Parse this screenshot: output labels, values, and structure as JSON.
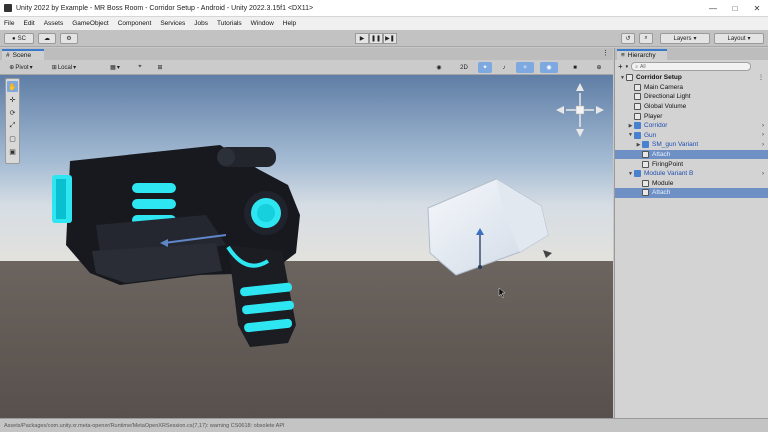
{
  "window": {
    "title": "Unity 2022 by Example - MR Boss Room - Corridor Setup - Android - Unity 2022.3.15f1 <DX11>",
    "controls": [
      "—",
      "□",
      "✕"
    ]
  },
  "menu": [
    "File",
    "Edit",
    "Assets",
    "GameObject",
    "Component",
    "Services",
    "Jobs",
    "Tutorials",
    "Window",
    "Help"
  ],
  "toolbar": {
    "account_label": "SC",
    "account_icon": "●",
    "cloud_icon": "☁",
    "settings_icon": "⚙",
    "play_icon": "▶",
    "pause_icon": "❚❚",
    "step_icon": "▶❚",
    "history_icon": "↺",
    "search_icon": "⌕",
    "layers_label": "Layers",
    "layout_label": "Layout"
  },
  "scene": {
    "tab_label": "Scene",
    "tab_icon": "#",
    "pivot_label": "Pivot",
    "local_label": "Local",
    "view_2d_label": "2D",
    "grid_icon": "▦",
    "snap_icon": "⌖",
    "gizmo_toggle": "◉",
    "menu_icon": "⋮"
  },
  "tools": [
    "✋",
    "✛",
    "⟳",
    "⤢",
    "▢",
    "▣"
  ],
  "hierarchy": {
    "tab_label": "Hierarchy",
    "tab_icon": "≡",
    "add_icon": "+",
    "search_placeholder": "All",
    "search_icon": "⌕",
    "items": [
      {
        "label": "Corridor Setup",
        "depth": 0,
        "arrow": "▼",
        "bold": true,
        "icon": "cube-gray",
        "selected": false,
        "blue": false,
        "more": true
      },
      {
        "label": "Main Camera",
        "depth": 1,
        "arrow": "",
        "bold": false,
        "icon": "cube-gray",
        "selected": false,
        "blue": false,
        "more": false
      },
      {
        "label": "Directional Light",
        "depth": 1,
        "arrow": "",
        "bold": false,
        "icon": "cube-gray",
        "selected": false,
        "blue": false,
        "more": false
      },
      {
        "label": "Global Volume",
        "depth": 1,
        "arrow": "",
        "bold": false,
        "icon": "cube-gray",
        "selected": false,
        "blue": false,
        "more": false
      },
      {
        "label": "Player",
        "depth": 1,
        "arrow": "",
        "bold": false,
        "icon": "cube-gray",
        "selected": false,
        "blue": false,
        "more": false
      },
      {
        "label": "Corridor",
        "depth": 1,
        "arrow": "▶",
        "bold": false,
        "icon": "cube-blue",
        "selected": false,
        "blue": true,
        "more": true
      },
      {
        "label": "Gun",
        "depth": 1,
        "arrow": "▼",
        "bold": false,
        "icon": "cube-blue",
        "selected": false,
        "blue": true,
        "more": true
      },
      {
        "label": "SM_gun Variant",
        "depth": 2,
        "arrow": "▶",
        "bold": false,
        "icon": "cube-blue",
        "selected": false,
        "blue": true,
        "more": true
      },
      {
        "label": "Attach",
        "depth": 2,
        "arrow": "",
        "bold": false,
        "icon": "cube-gray",
        "selected": true,
        "blue": false,
        "more": false
      },
      {
        "label": "FiringPoint",
        "depth": 2,
        "arrow": "",
        "bold": false,
        "icon": "cube-gray",
        "selected": false,
        "blue": false,
        "more": false
      },
      {
        "label": "Module Variant B",
        "depth": 1,
        "arrow": "▼",
        "bold": false,
        "icon": "cube-blue",
        "selected": false,
        "blue": true,
        "more": true
      },
      {
        "label": "Module",
        "depth": 2,
        "arrow": "",
        "bold": false,
        "icon": "cube-gray",
        "selected": false,
        "blue": false,
        "more": false
      },
      {
        "label": "Attach",
        "depth": 2,
        "arrow": "",
        "bold": false,
        "icon": "cube-gray",
        "selected": true,
        "blue": false,
        "more": false
      }
    ]
  },
  "status": {
    "text": "Assets/Packages/com.unity.xr.meta-openxr/Runtime/MetaOpenXRSession.cs(7,17): warning CS0618: obsolete API"
  },
  "colors": {
    "accent": "#3a79c9",
    "selection": "#6e90c4",
    "prefab_blue": "#4a80d0",
    "gun_cyan": "#2ee6f2"
  }
}
